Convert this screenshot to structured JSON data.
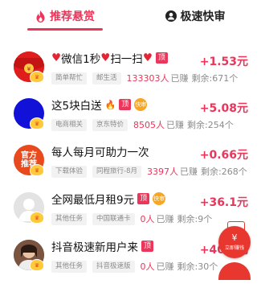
{
  "tabs": [
    {
      "label": "推荐悬赏",
      "icon": "flame-icon",
      "active": true
    },
    {
      "label": "极速快审",
      "icon": "user-icon",
      "active": false
    }
  ],
  "tasks": [
    {
      "title_parts": [
        "微信1秒",
        "扫一扫"
      ],
      "badge": "顶",
      "tags": [
        "简单帮忙",
        "邮生活"
      ],
      "count": "133303人",
      "earned": "已赚",
      "remain": "剩余:671个",
      "price": "+1.53元"
    },
    {
      "title": "这5块白送",
      "badge": "顶",
      "quick": "快审",
      "tags": [
        "电商相关",
        "京东特价"
      ],
      "count": "8505人",
      "earned": "已赚",
      "remain": "剩余:254个",
      "price": "+5.08元"
    },
    {
      "title": "每人每月可助力一次",
      "tags": [
        "下载体验",
        "同程旅行-8月"
      ],
      "count": "3397人",
      "earned": "已赚",
      "remain": "剩余:268个",
      "price": "+0.66元",
      "avatar_text": [
        "官方",
        "推荐"
      ]
    },
    {
      "title": "全网最低月租9元",
      "badge": "顶",
      "quick": "快审",
      "tags": [
        "其他任务",
        "中国联通卡"
      ],
      "count": "0人",
      "earned": "已赚",
      "remain": "剩余:9个",
      "price": "+36.1元"
    },
    {
      "title": "抖音极速新用户来",
      "badge": "顶",
      "tags": [
        "其他任务",
        "抖音极速版"
      ],
      "count": "0人",
      "earned": "已赚",
      "remain": "剩余:30个",
      "price": "+40.0元"
    }
  ],
  "float_widget": {
    "label": "立即赚钱"
  },
  "colors": {
    "accent": "#e9365a",
    "tag_bg": "#f2f2f2",
    "muted": "#8b8b8b"
  }
}
